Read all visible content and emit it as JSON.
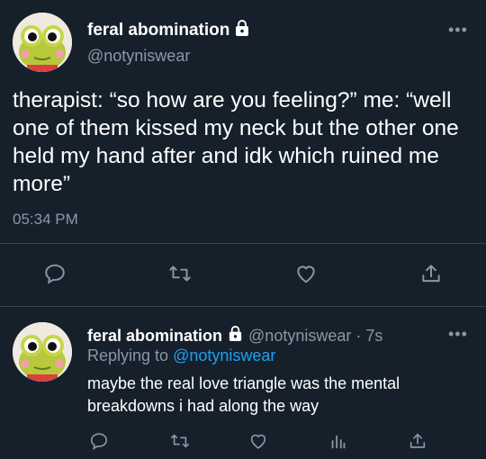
{
  "colors": {
    "background": "#15202b",
    "text": "#ffffff",
    "muted": "#8899a6",
    "link": "#1da1f2",
    "divider": "#38444d"
  },
  "main_tweet": {
    "display_name": "feral abomination",
    "handle": "@notyniswear",
    "protected_icon": "lock-icon",
    "more_label": "•••",
    "text": "therapist: “so how are you feeling?” me: “well one of them kissed my neck but the other one held my hand after and idk which ruined me more”",
    "time": "05:34 PM",
    "actions": [
      "reply-icon",
      "retweet-icon",
      "like-icon",
      "share-icon"
    ]
  },
  "reply_tweet": {
    "display_name": "feral abomination",
    "handle": "@notyniswear",
    "age": "· 7s",
    "protected_icon": "lock-icon",
    "more_label": "•••",
    "replying_prefix": "Replying to",
    "replying_to": "@notyniswear",
    "text": "maybe the real love triangle was the mental breakdowns i had along the way",
    "actions": [
      "reply-icon",
      "retweet-icon",
      "like-icon",
      "analytics-icon",
      "share-icon"
    ]
  }
}
